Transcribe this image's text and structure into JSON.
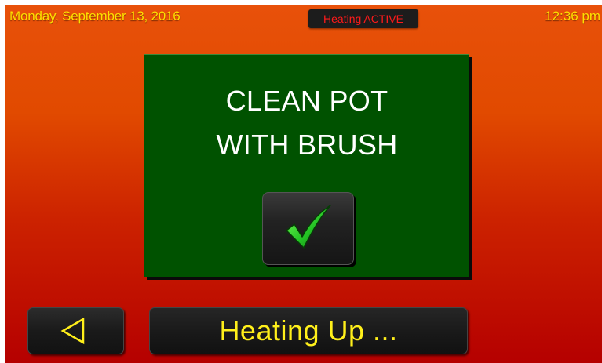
{
  "header": {
    "date": "Monday, September 13, 2016",
    "status_badge": "Heating ACTIVE",
    "time": "12:36 pm"
  },
  "prompt": {
    "line1": "CLEAN POT",
    "line2": "WITH BRUSH",
    "confirm_icon": "checkmark-icon"
  },
  "footer": {
    "back_icon": "back-triangle-icon",
    "status_text": "Heating Up ..."
  },
  "colors": {
    "header_text": "#ffdf00",
    "badge_text": "#ff1a1a",
    "panel_bg": "#005200",
    "status_text": "#ffef1a",
    "check_green": "#2ecc2e",
    "back_icon": "#ffef1a"
  }
}
